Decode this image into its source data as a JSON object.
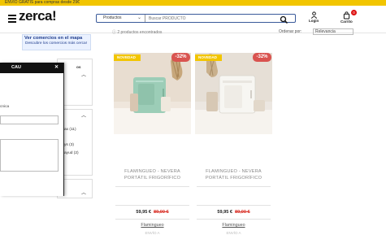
{
  "topbar": {
    "text": "ENVÍO GRATIS para compras desde 29€"
  },
  "header": {
    "logo": "zerca!",
    "search": {
      "category": "Productos",
      "query": "Buscar PRODUCTO"
    },
    "login_label": "Login",
    "cart_label": "Carrito",
    "cart_count": "0"
  },
  "promo": {
    "title": "Ver comercios en el mapa",
    "subtitle": "Descubre los comercios más cerca!"
  },
  "listing": {
    "results_text": "2 productos encontrados",
    "order_label": "Ordenar por:",
    "order_value": "Relevancia"
  },
  "filter": {
    "title": "CAU",
    "close": "✕",
    "label_1": "cnica",
    "label_2": "e",
    "bg_heading": "os",
    "bg_counts": [
      "ax (11)",
      "ys (3)",
      "ayud (2)"
    ]
  },
  "products": [
    {
      "tag": "NOVEDAD",
      "discount": "-32%",
      "name": "FLAMINGUEO - NEVERA PORTÁTIL FRIGORÍFICO",
      "price": "59,95 €",
      "old_price": "89,00 €",
      "seller": "Flamingueo",
      "shipping": "ENVÍO A",
      "color": "#9ccdb7"
    },
    {
      "tag": "NOVEDAD",
      "discount": "-32%",
      "name": "FLAMINGUEO - NEVERA PORTÁTIL FRIGORÍFICO",
      "price": "59,95 €",
      "old_price": "89,00 €",
      "seller": "Flamingueo",
      "shipping": "ENVÍO A",
      "color": "#f5f4f0"
    }
  ],
  "colors": {
    "accent": "#f2c500",
    "discount": "#d9534f",
    "brand_blue": "#1e3c8c"
  }
}
